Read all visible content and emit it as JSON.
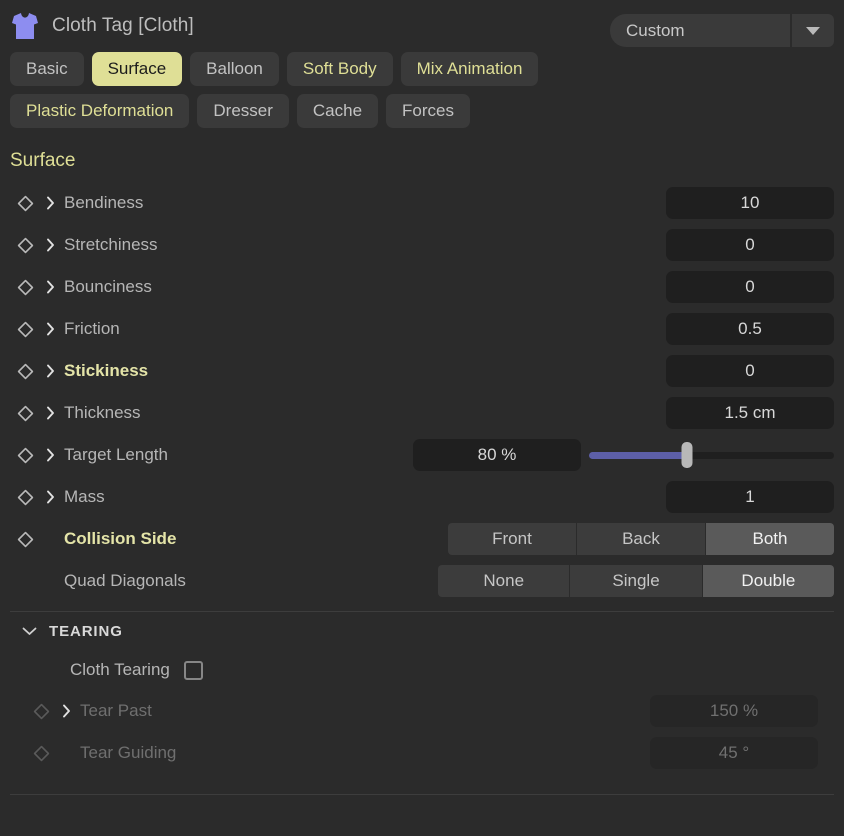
{
  "header": {
    "icon": "tshirt-icon",
    "title": "Cloth Tag [Cloth]",
    "preset_value": "Custom",
    "preset_arrow_icon": "chevron-down-icon"
  },
  "tabs_row1": [
    {
      "label": "Basic",
      "state": "normal"
    },
    {
      "label": "Surface",
      "state": "active"
    },
    {
      "label": "Balloon",
      "state": "normal"
    },
    {
      "label": "Soft Body",
      "state": "accent"
    },
    {
      "label": "Mix Animation",
      "state": "accent"
    }
  ],
  "tabs_row2": [
    {
      "label": "Plastic Deformation",
      "state": "accent"
    },
    {
      "label": "Dresser",
      "state": "normal"
    },
    {
      "label": "Cache",
      "state": "normal"
    },
    {
      "label": "Forces",
      "state": "normal"
    }
  ],
  "surface": {
    "title": "Surface",
    "properties": [
      {
        "label": "Bendiness",
        "value": "10",
        "accent": false
      },
      {
        "label": "Stretchiness",
        "value": "0",
        "accent": false
      },
      {
        "label": "Bounciness",
        "value": "0",
        "accent": false
      },
      {
        "label": "Friction",
        "value": "0.5",
        "accent": false
      },
      {
        "label": "Stickiness",
        "value": "0",
        "accent": true
      },
      {
        "label": "Thickness",
        "value": "1.5 cm",
        "accent": false
      },
      {
        "label": "Target Length",
        "value": "80 %",
        "accent": false,
        "slider": 40
      },
      {
        "label": "Mass",
        "value": "1",
        "accent": false
      }
    ],
    "collision_side": {
      "label": "Collision Side",
      "options": [
        "Front",
        "Back",
        "Both"
      ],
      "selected": "Both"
    },
    "quad_diagonals": {
      "label": "Quad Diagonals",
      "options": [
        "None",
        "Single",
        "Double"
      ],
      "selected": "Double"
    }
  },
  "tearing": {
    "title": "TEARING",
    "collapse_icon": "chevron-down-icon",
    "cloth_tearing": {
      "label": "Cloth Tearing",
      "checked": false
    },
    "properties": [
      {
        "label": "Tear Past",
        "value": "150 %",
        "has_chevron": true
      },
      {
        "label": "Tear Guiding",
        "value": "45 °",
        "has_chevron": false
      }
    ]
  },
  "colors": {
    "background": "#2b2b2b",
    "accent_yellow": "#dfdf96",
    "slider_fill": "#5d5fa8",
    "icon_purple": "#8d8df0"
  }
}
